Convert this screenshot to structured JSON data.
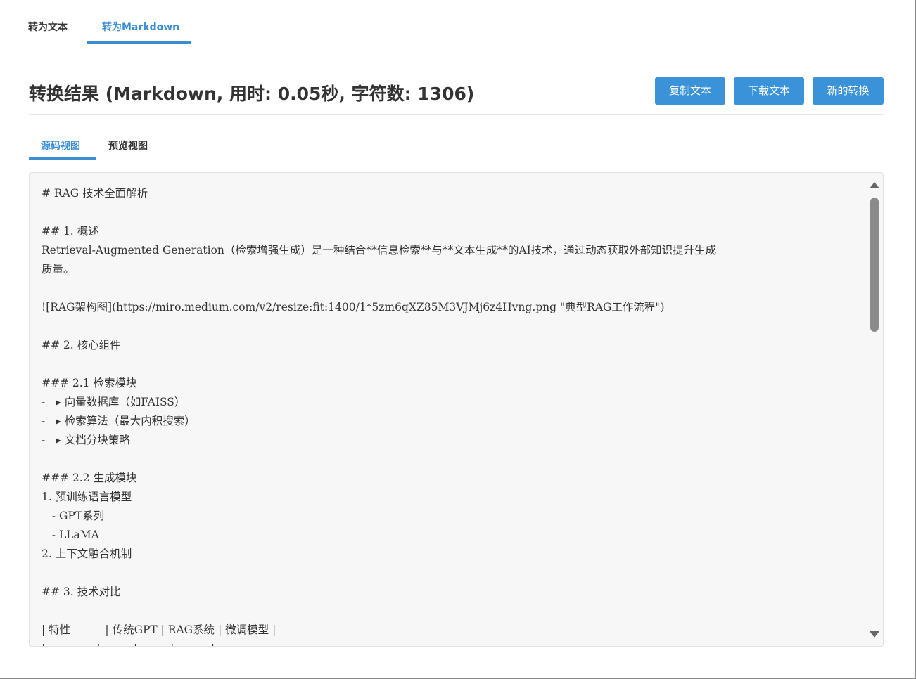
{
  "top_tabs": {
    "text_tab": "转为文本",
    "markdown_tab": "转为Markdown"
  },
  "header": {
    "title": "转换结果 (Markdown, 用时: 0.05秒, 字符数: 1306)",
    "copy_button": "复制文本",
    "download_button": "下载文本",
    "new_button": "新的转换"
  },
  "view_tabs": {
    "source": "源码视图",
    "preview": "预览视图"
  },
  "code_lines": [
    "# RAG 技术全面解析",
    "",
    "## 1. 概述",
    "Retrieval-Augmented Generation（检索增强生成）是一种结合**信息检索**与**文本生成**的AI技术，通过动态获取外部知识提升生成",
    "质量。",
    "",
    "![RAG架构图](https://miro.medium.com/v2/resize:fit:1400/1*5zm6qXZ85M3VJMj6z4Hvng.png \"典型RAG工作流程\")",
    "",
    "## 2. 核心组件",
    "",
    "### 2.1 检索模块",
    "-   ▸ 向量数据库（如FAISS）",
    "-   ▸ 检索算法（最大内积搜索）",
    "-   ▸ 文档分块策略",
    "",
    "### 2.2 生成模块",
    "1. 预训练语言模型",
    "   - GPT系列",
    "   - LLaMA",
    "2. 上下文融合机制",
    "",
    "## 3. 技术对比",
    "",
    "| 特性          | 传统GPT | RAG系统 | 微调模型 |",
    "|--------------|---------|---------|----------|"
  ],
  "icons": {
    "scroll_up": "triangle-up-icon",
    "scroll_down": "triangle-down-icon"
  },
  "colors": {
    "accent": "#3a8ed4",
    "button": "#3a93d8",
    "code_bg": "#f7f7f7"
  }
}
